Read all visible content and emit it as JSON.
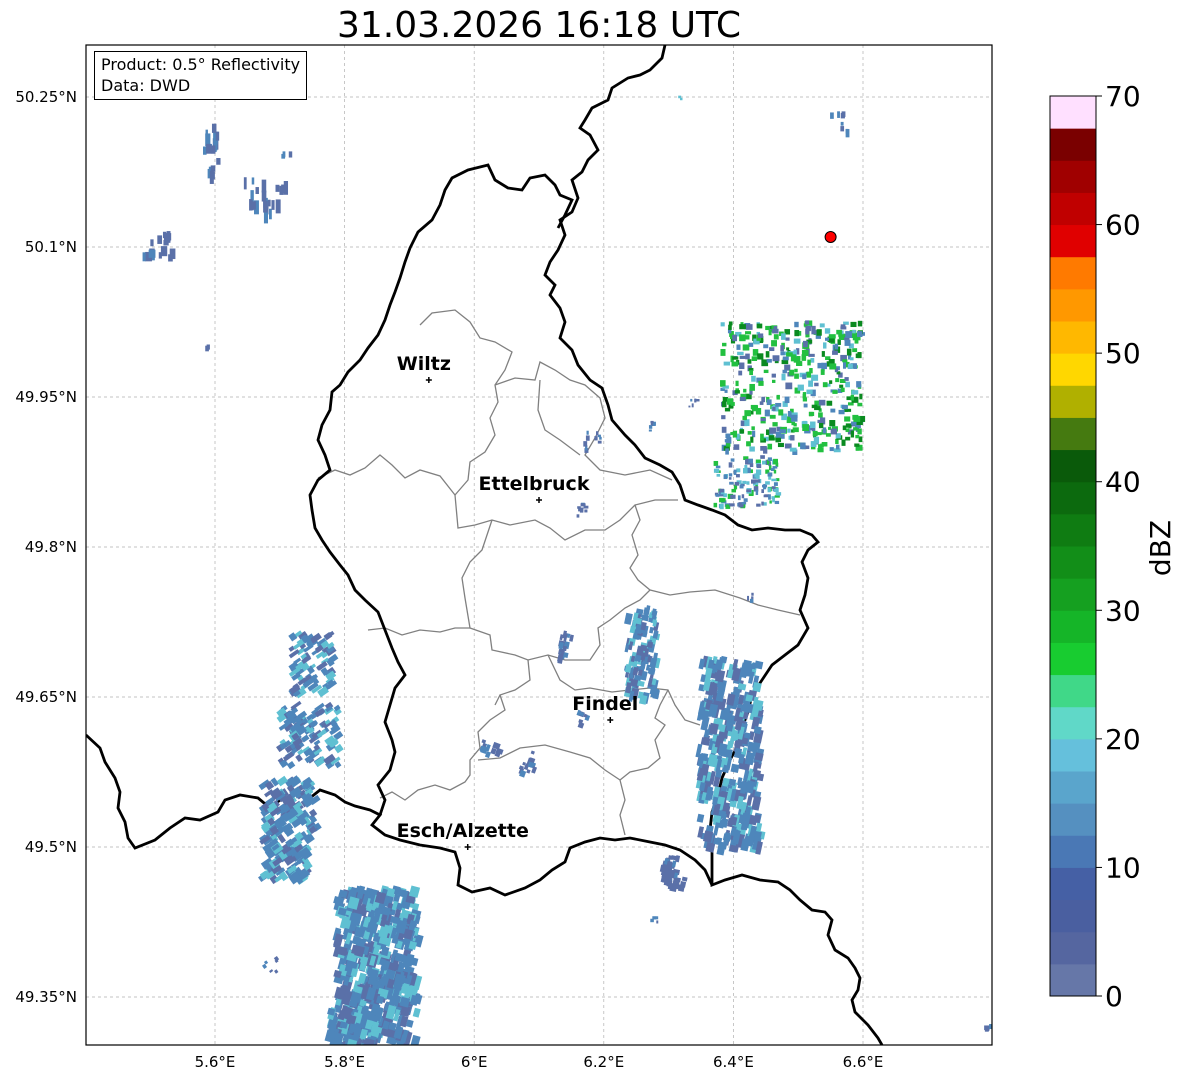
{
  "title": "31.03.2026 16:18 UTC",
  "info": {
    "product": "Product: 0.5° Reflectivity",
    "data_source": "Data: DWD"
  },
  "axes": {
    "lon_ticks": [
      "5.6°E",
      "5.8°E",
      "6°E",
      "6.2°E",
      "6.4°E",
      "6.6°E"
    ],
    "lat_ticks": [
      "50.25°N",
      "50.1°N",
      "49.95°N",
      "49.8°N",
      "49.65°N",
      "49.5°N",
      "49.35°N"
    ]
  },
  "cities": [
    {
      "name": "Wiltz",
      "lon": 5.93,
      "lat": 49.967
    },
    {
      "name": "Ettelbruck",
      "lon": 6.1,
      "lat": 49.847
    },
    {
      "name": "Findel",
      "lon": 6.21,
      "lat": 49.627
    },
    {
      "name": "Esch/Alzette",
      "lon": 5.99,
      "lat": 49.5
    }
  ],
  "radar_site": {
    "lon": 6.55,
    "lat": 50.11,
    "color": "#ff0000"
  },
  "colorbar": {
    "label": "dBZ",
    "ticks": [
      "0",
      "10",
      "20",
      "30",
      "40",
      "50",
      "60",
      "70"
    ],
    "min": 0,
    "max": 70,
    "step": 2.5,
    "colors": [
      "#6677a8",
      "#5566a0",
      "#4a5fa0",
      "#4560a5",
      "#4a78b5",
      "#5590c0",
      "#5aa5cc",
      "#65c0dc",
      "#60d8c8",
      "#40d888",
      "#18cc30",
      "#15b528",
      "#15a020",
      "#128e18",
      "#0f7c12",
      "#0c6a0e",
      "#0a5a0a",
      "#457a10",
      "#b0b000",
      "#ffd700",
      "#ffb800",
      "#ff9800",
      "#ff7a00",
      "#e00000",
      "#c00000",
      "#a00000",
      "#7a0000",
      "#ffe0ff",
      "#ffb0ff",
      "#ff70ff",
      "#e838e8"
    ]
  },
  "echo_colors": {
    "low": "#5a70a8",
    "mid": "#4e86bb",
    "high": "#5fc0d2",
    "green": "#22c040",
    "dark_green": "#0a8a20"
  },
  "chart_data": {
    "type": "heatmap",
    "title": "31.03.2026 16:18 UTC",
    "xlabel": "",
    "ylabel": "",
    "value_label": "dBZ",
    "value_range": [
      0,
      70
    ],
    "lon_range": [
      5.405,
      6.79
    ],
    "lat_range": [
      49.3,
      50.3
    ]
  }
}
